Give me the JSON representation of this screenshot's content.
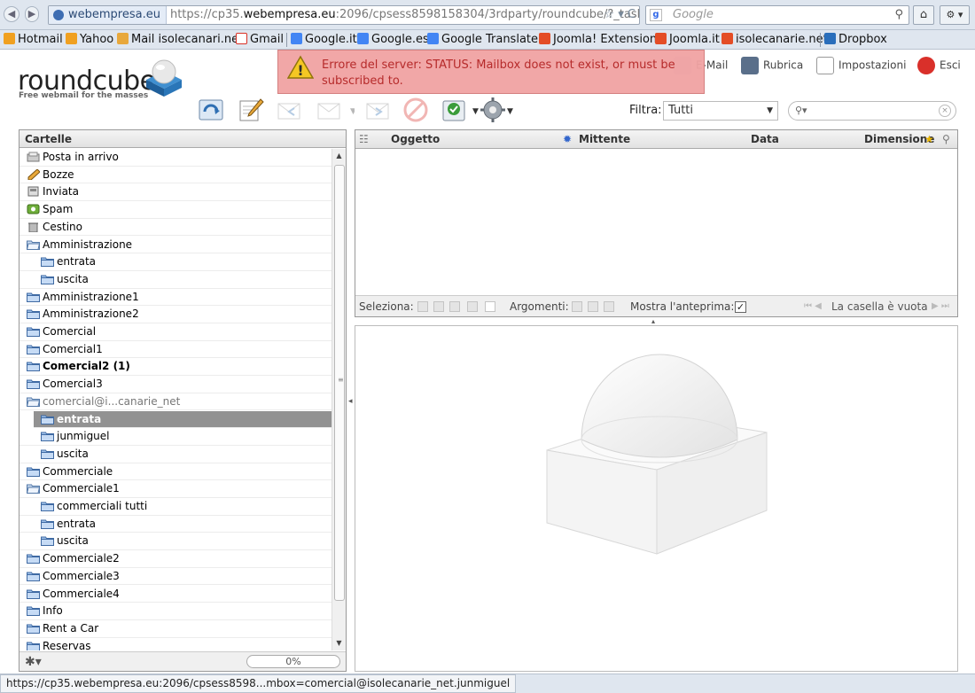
{
  "browser": {
    "back_glyph": "◀",
    "forward_glyph": "▶",
    "site_label": "webempresa.eu",
    "url_prefix": "https://cp35.",
    "url_host": "webempresa.eu",
    "url_rest": ":2096/cpsess8598158304/3rdparty/roundcube/?_task=r",
    "url_tail": "☆ ▾ C",
    "search_engine_glyph": "g",
    "search_placeholder": "Google",
    "search_glyph": "⚲",
    "home_glyph": "⌂",
    "ext_glyph": "⚙ ▾",
    "bookmarks": [
      {
        "label": "Hotmail",
        "icon": "hotmail-icon",
        "color": "#f0a020"
      },
      {
        "label": "Yahoo",
        "icon": "yahoo-icon",
        "color": "#f0a020"
      },
      {
        "label": "Mail isolecanari.net",
        "icon": "mail-icon",
        "color": "#e8a83c"
      },
      {
        "label": "Gmail",
        "icon": "gmail-icon",
        "color": "#d93025"
      },
      {
        "label": "Google.it",
        "icon": "google-icon",
        "color": "#4285f4"
      },
      {
        "label": "Google.es",
        "icon": "google-icon",
        "color": "#4285f4"
      },
      {
        "label": "Google Translate",
        "icon": "translate-icon",
        "color": "#4285f4"
      },
      {
        "label": "Joomla! Extensions",
        "icon": "joomla-icon",
        "color": "#e44d26"
      },
      {
        "label": "Joomla.it",
        "icon": "joomla-icon",
        "color": "#e44d26"
      },
      {
        "label": "isolecanarie.net",
        "icon": "joomla-icon",
        "color": "#e44d26"
      },
      {
        "label": "Dropbox",
        "icon": "dropbox-icon",
        "color": "#2a6ebb"
      }
    ],
    "status_text": "https://cp35.webempresa.eu:2096/cpsess8598...mbox=comercial@isolecanarie_net.junmiguel"
  },
  "app": {
    "logo_text": "roundcube",
    "logo_tagline": "Free webmail for the masses",
    "tasks": [
      {
        "label": "E-Mail",
        "icon": "mail-icon"
      },
      {
        "label": "Rubrica",
        "icon": "addressbook-icon"
      },
      {
        "label": "Impostazioni",
        "icon": "settings-icon"
      },
      {
        "label": "Esci",
        "icon": "logout-icon"
      }
    ],
    "error_message": "Errore del server: STATUS: Mailbox does not exist, or must be subscribed to.",
    "warning_glyph": "!",
    "filter_label": "Filtra:",
    "filter_value": "Tutti",
    "select_arrow": "▼",
    "search_glyph": "⚲▾",
    "clear_glyph": "×",
    "colors": {
      "selected": "#929292",
      "error_bg": "#f1a3a3",
      "error_text": "#b32020"
    }
  },
  "folders": {
    "header": "Cartelle",
    "items": [
      {
        "label": "Posta in arrivo",
        "icon": "inbox-icon",
        "level": 0
      },
      {
        "label": "Bozze",
        "icon": "drafts-icon",
        "level": 0
      },
      {
        "label": "Inviata",
        "icon": "sent-icon",
        "level": 0
      },
      {
        "label": "Spam",
        "icon": "spam-icon",
        "level": 0
      },
      {
        "label": "Cestino",
        "icon": "trash-icon",
        "level": 0
      },
      {
        "label": "Amministrazione",
        "icon": "folder-open-icon",
        "level": 0
      },
      {
        "label": "entrata",
        "icon": "folder-icon",
        "level": 1
      },
      {
        "label": "uscita",
        "icon": "folder-icon",
        "level": 1
      },
      {
        "label": "Amministrazione1",
        "icon": "folder-icon",
        "level": 0
      },
      {
        "label": "Amministrazione2",
        "icon": "folder-icon",
        "level": 0
      },
      {
        "label": "Comercial",
        "icon": "folder-icon",
        "level": 0
      },
      {
        "label": "Comercial1",
        "icon": "folder-icon",
        "level": 0
      },
      {
        "label": "Comercial2 (1)",
        "icon": "folder-icon",
        "level": 0,
        "state": "unread"
      },
      {
        "label": "Comercial3",
        "icon": "folder-icon",
        "level": 0
      },
      {
        "label": "comercial@i...canarie_net",
        "icon": "folder-open-icon",
        "level": 0,
        "state": "account"
      },
      {
        "label": "entrata",
        "icon": "folder-icon",
        "level": 1,
        "state": "selected"
      },
      {
        "label": "junmiguel",
        "icon": "folder-icon",
        "level": 1
      },
      {
        "label": "uscita",
        "icon": "folder-icon",
        "level": 1
      },
      {
        "label": "Commerciale",
        "icon": "folder-icon",
        "level": 0
      },
      {
        "label": "Commerciale1",
        "icon": "folder-open-icon",
        "level": 0
      },
      {
        "label": "commerciali tutti",
        "icon": "folder-icon",
        "level": 1
      },
      {
        "label": "entrata",
        "icon": "folder-icon",
        "level": 1
      },
      {
        "label": "uscita",
        "icon": "folder-icon",
        "level": 1
      },
      {
        "label": "Commerciale2",
        "icon": "folder-icon",
        "level": 0
      },
      {
        "label": "Commerciale3",
        "icon": "folder-icon",
        "level": 0
      },
      {
        "label": "Commerciale4",
        "icon": "folder-icon",
        "level": 0
      },
      {
        "label": "Info",
        "icon": "folder-icon",
        "level": 0
      },
      {
        "label": "Rent a Car",
        "icon": "folder-icon",
        "level": 0
      },
      {
        "label": "Reservas",
        "icon": "folder-icon",
        "level": 0
      }
    ],
    "quota": "0%",
    "gear_glyph": "✱▾",
    "scroll_up": "▲",
    "scroll_down": "▼",
    "grip": "≡"
  },
  "messages": {
    "col_subject": "Oggetto",
    "col_from": "Mittente",
    "col_date": "Data",
    "col_size": "Dimensione",
    "select_label": "Seleziona:",
    "threads_label": "Argomenti:",
    "preview_label": "Mostra l'anteprima:",
    "preview_checked": "✓",
    "empty_text": "La casella è vuota",
    "pager_first": "⏮ ◀",
    "pager_last": "▶ ⏭",
    "splitter_v": "◂",
    "splitter_h": "▴"
  }
}
